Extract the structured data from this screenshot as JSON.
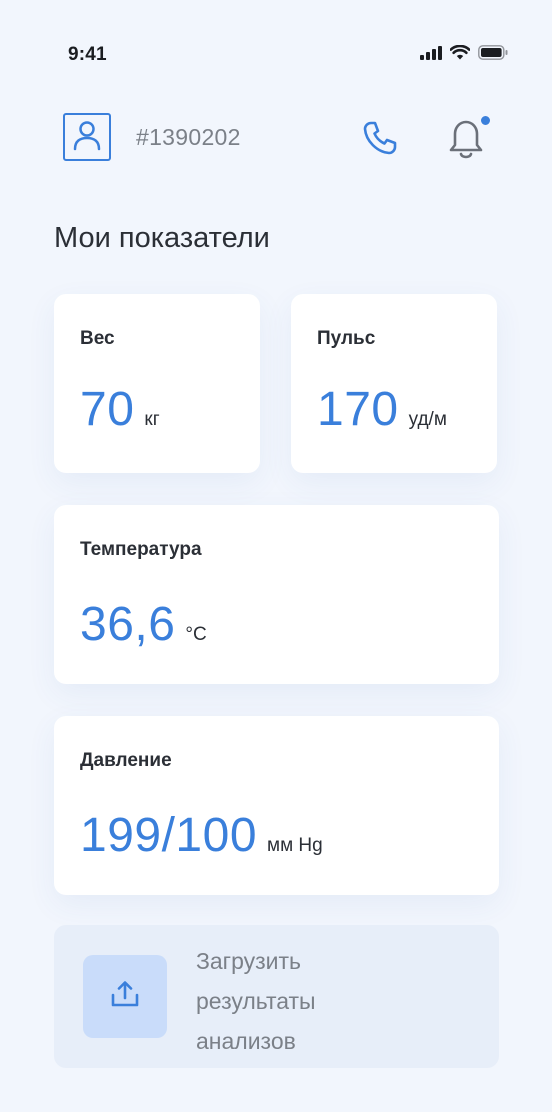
{
  "status_bar": {
    "time": "9:41",
    "icons": [
      "cellular-signal-icon",
      "wifi-icon",
      "battery-icon"
    ]
  },
  "header": {
    "avatar_icon": "user-profile-icon",
    "patient_id": "#1390202",
    "phone_icon": "phone-icon",
    "notifications_icon": "bell-icon",
    "has_unread_notifications": true
  },
  "section": {
    "title": "Мои показатели"
  },
  "metrics": {
    "weight": {
      "label": "Вес",
      "value": "70",
      "unit": "кг"
    },
    "pulse": {
      "label": "Пульс",
      "value": "170",
      "unit": "уд/м"
    },
    "temperature": {
      "label": "Температура",
      "value": "36,6",
      "unit": "°C"
    },
    "pressure": {
      "label": "Давление",
      "value": "199/100",
      "unit": "мм Hg"
    }
  },
  "upload": {
    "icon": "upload-icon",
    "label": "Загрузить результаты анализов"
  },
  "colors": {
    "accent": "#3a7fdb",
    "background": "#f2f6fd",
    "card": "#ffffff",
    "upload_bg": "#e7eef9",
    "upload_icon_bg": "#c9dcfa",
    "muted_text": "#7b8088"
  }
}
